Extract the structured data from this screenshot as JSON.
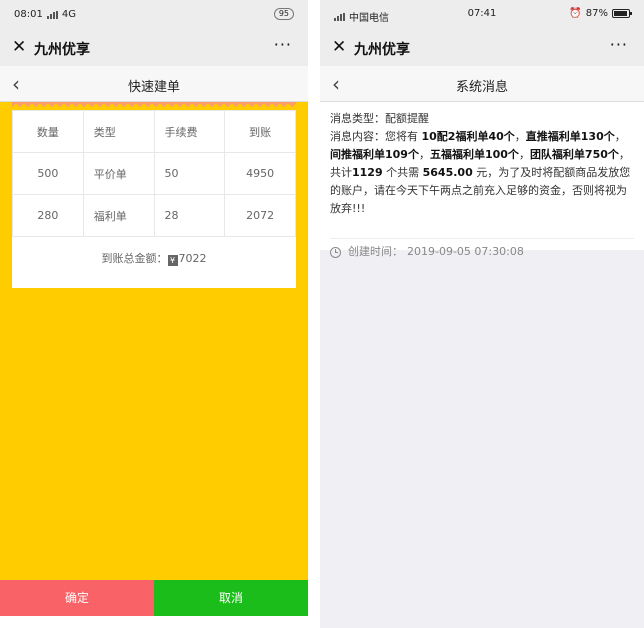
{
  "left": {
    "status": {
      "time": "08:01",
      "network": "4G",
      "battery": "95"
    },
    "title": "九州优享",
    "more": "···",
    "nav_title": "快速建单",
    "table": {
      "headers": [
        "数量",
        "类型",
        "手续费",
        "到账"
      ],
      "rows": [
        [
          "500",
          "平价单",
          "50",
          "4950"
        ],
        [
          "280",
          "福利单",
          "28",
          "2072"
        ]
      ]
    },
    "total_label": "到账总金额：",
    "total_icon": "¥",
    "total_value": "7022",
    "confirm_label": "确定",
    "cancel_label": "取消",
    "colors": {
      "background": "#ffcc00",
      "confirm": "#f96266",
      "cancel": "#1bbd1b"
    }
  },
  "right": {
    "status": {
      "carrier": "中国电信",
      "time": "07:41",
      "battery": "87%"
    },
    "title": "九州优享",
    "more": "···",
    "nav_title": "系统消息",
    "message": {
      "type_label": "消息类型：",
      "type_value": "配额提醒",
      "content_label": "消息内容：",
      "t1": "您将有 ",
      "b1": "10配2福利单40个",
      "t2": "，",
      "b2": "直推福利单130个",
      "t3": "，",
      "b3": "间推福利单109个",
      "t4": "，",
      "b4": "五福福利单100个",
      "t5": "，",
      "b5": "团队福利单750个",
      "t6": "，共计",
      "b6": "1129",
      "t7": " 个共需 ",
      "b7": "5645.00",
      "t8": " 元，为了及时将配额商品发放您的账户，请在今天下午两点之前充入足够的资金，否则将视为放弃!!!",
      "created_label": "创建时间：",
      "created_value": "2019-09-05 07:30:08"
    }
  }
}
